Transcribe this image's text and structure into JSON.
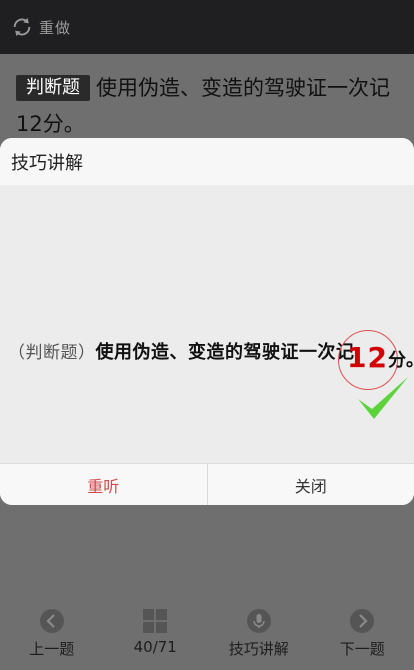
{
  "topbar": {
    "redo_label": "重做"
  },
  "question": {
    "type_tag": "判断题",
    "text": "使用伪造、变造的驾驶证一次记12分。"
  },
  "dialog": {
    "title": "技巧讲解",
    "explain_prefix": "（判断题）",
    "explain_text": "使用伪造、变造的驾驶证一次记",
    "highlight_number": "12",
    "explain_suffix": "分。",
    "answer": "correct",
    "buttons": {
      "replay": "重听",
      "close": "关闭"
    }
  },
  "bottomnav": {
    "prev": "上一题",
    "progress": "40/71",
    "tips": "技巧讲解",
    "next": "下一题"
  },
  "colors": {
    "accent_red": "#d40000",
    "check_green": "#5cd33a"
  }
}
